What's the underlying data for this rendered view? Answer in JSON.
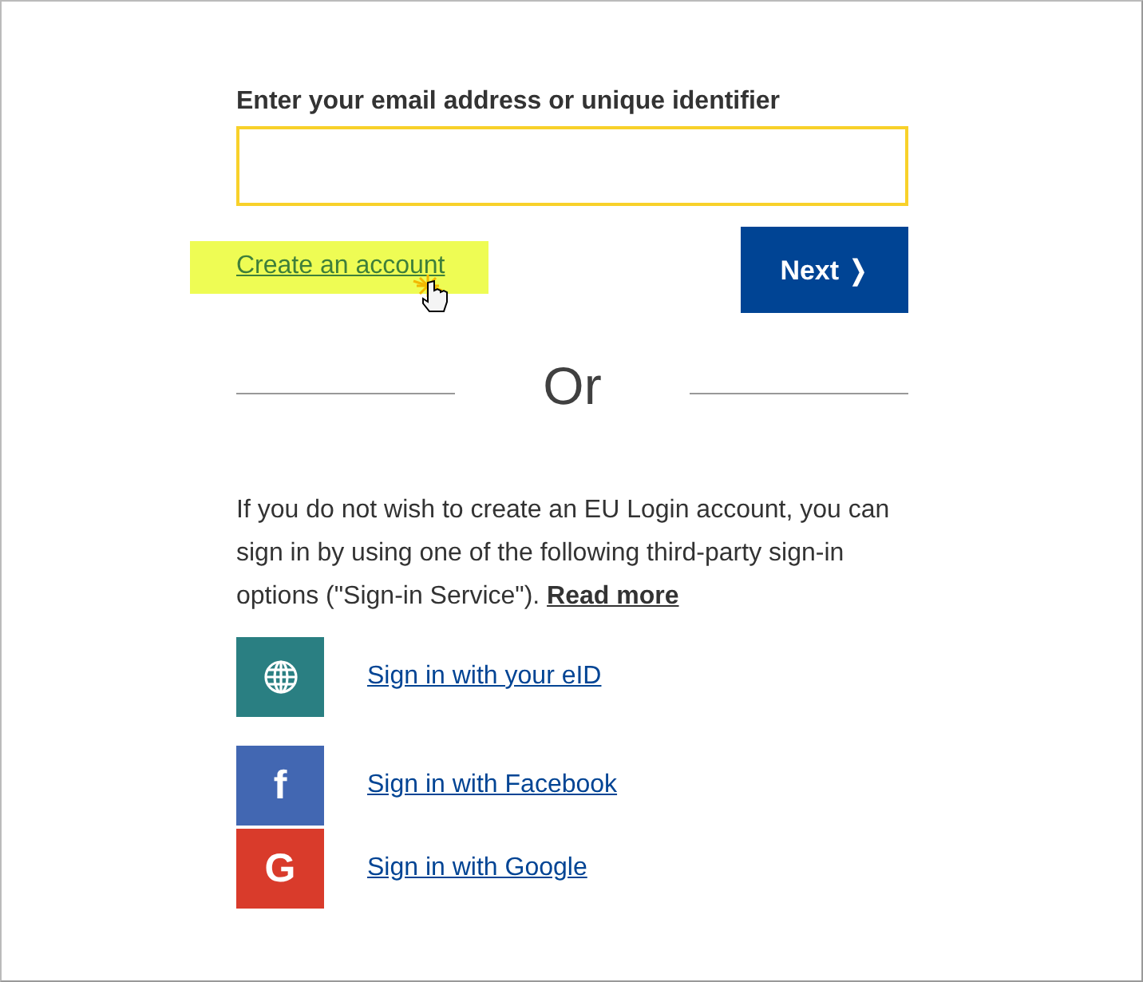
{
  "email_field": {
    "label": "Enter your email address or unique identifier"
  },
  "create_account": {
    "label": "Create an account",
    "highlighted": true
  },
  "next_button": {
    "label": "Next",
    "glyph": "❭"
  },
  "divider": {
    "label": "Or"
  },
  "info_text": "If you do not wish to create an EU Login account, you can sign in by using one of the following third-party sign-in options (\"Sign-in Service\").",
  "read_more": "Read more",
  "sign_in_options": [
    {
      "kind": "globe",
      "label": "Sign in with your eID",
      "color": "#2a7f82"
    },
    {
      "kind": "glyph",
      "glyph": "f",
      "label": "Sign in with Facebook",
      "color": "#4267b2"
    },
    {
      "kind": "glyph",
      "glyph": "G",
      "label": "Sign in with Google",
      "color": "#d93b2b"
    }
  ]
}
